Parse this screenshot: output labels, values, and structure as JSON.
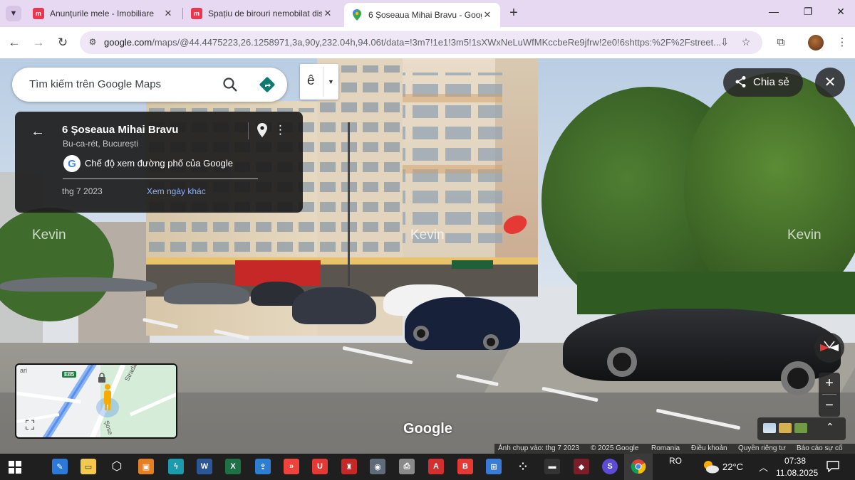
{
  "browser": {
    "tabs": [
      {
        "title": "Anunțurile mele - Imobiliare",
        "favicon": "imobiliare-logo-icon",
        "active": false
      },
      {
        "title": "Spațiu de birouri nemobilat dis",
        "favicon": "imobiliare-logo-icon",
        "active": false
      },
      {
        "title": "6 Șoseaua Mihai Bravu - Googl",
        "favicon": "google-maps-pin-icon",
        "active": true
      }
    ],
    "new_tab_label": "+",
    "url_domain": "google.com",
    "url_rest": "/maps/@44.4475223,26.1258971,3a,90y,232.04h,94.06t/data=!3m7!1e1!3m5!1sXWxNeLuWfMKccbeRe9jfrw!2e0!6shttps:%2F%2Fstreet..."
  },
  "maps": {
    "search_placeholder": "Tìm kiếm trên Google Maps",
    "lang_button": "ê",
    "place": {
      "address": "6 Șoseaua Mihai Bravu",
      "locality": "Bu-ca-rét, București",
      "mode_label": "Chế độ xem đường phố của Google",
      "capture_date": "thg 7 2023",
      "other_dates_link": "Xem ngày khác"
    },
    "share_label": "Chia sẻ",
    "watermarks": [
      "Kevin",
      "Kevin",
      "Kevin"
    ],
    "google_logo": "Google",
    "minimap": {
      "route_shield": "E85",
      "street_label": "Strada Christigiil",
      "road_label": "Șose",
      "corner_text": "ari"
    },
    "footer": {
      "capture_info": "Ảnh chụp vào: thg 7 2023",
      "copyright": "© 2025 Google",
      "country": "Romania",
      "terms": "Điều khoản",
      "privacy": "Quyền riêng tư",
      "report": "Báo cáo sự cố"
    },
    "zoom_in": "+",
    "zoom_out": "−",
    "close": "✕",
    "accent_blue": "#1a73e8",
    "directions_teal": "#0b7a70"
  },
  "taskbar": {
    "language": "RO",
    "temperature": "22°C",
    "time": "07:38",
    "date": "11.08.2025",
    "apps": [
      "windows-start-icon",
      "paint-icon",
      "file-explorer-icon",
      "hexagon-app-icon",
      "office-icon",
      "flash-app-icon",
      "word-icon",
      "excel-icon",
      "upload-app-icon",
      "anydesk-icon",
      "ultraviewer-icon",
      "red-app-icon",
      "camera-icon",
      "printer-app-icon",
      "acrobat-icon",
      "b-app-icon",
      "store-icon",
      "dots-app-icon",
      "dark-app-icon",
      "ruby-app-icon",
      "skype-icon",
      "chrome-icon"
    ]
  }
}
